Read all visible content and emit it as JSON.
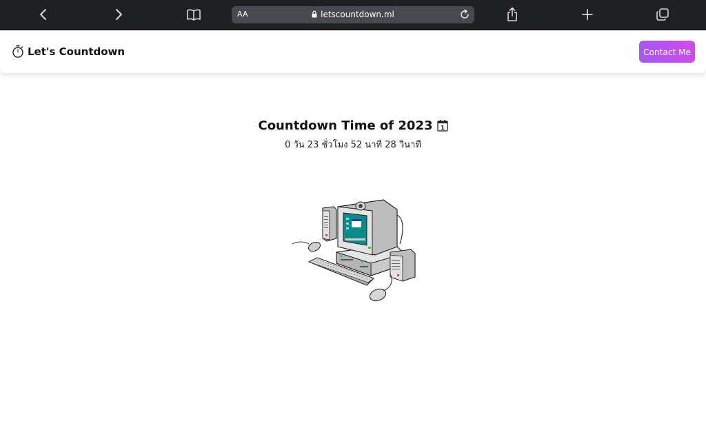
{
  "browser": {
    "url": "letscountdown.ml",
    "reader_label": "AA",
    "icons": [
      "back-icon",
      "forward-icon",
      "bookmarks-icon",
      "lock-icon",
      "reload-icon",
      "share-icon",
      "new-tab-icon",
      "tabs-icon"
    ]
  },
  "header": {
    "brand": "Let's Countdown",
    "brand_icon": "stopwatch-icon",
    "contact_label": "Contact Me",
    "contact_gradient": [
      "#a458f5",
      "#d04ae8"
    ]
  },
  "main": {
    "title": "Countdown Time of 2023",
    "title_icon": "calendar-icon",
    "calendar_digit": "1",
    "countdown": "0 วัน 23 ชั่วโมง 52 นาที 28 วินาที",
    "illustration": "computer-icon"
  },
  "colors": {
    "toolbar_bg": "#1f2024",
    "urlbar_bg": "#48494e"
  }
}
